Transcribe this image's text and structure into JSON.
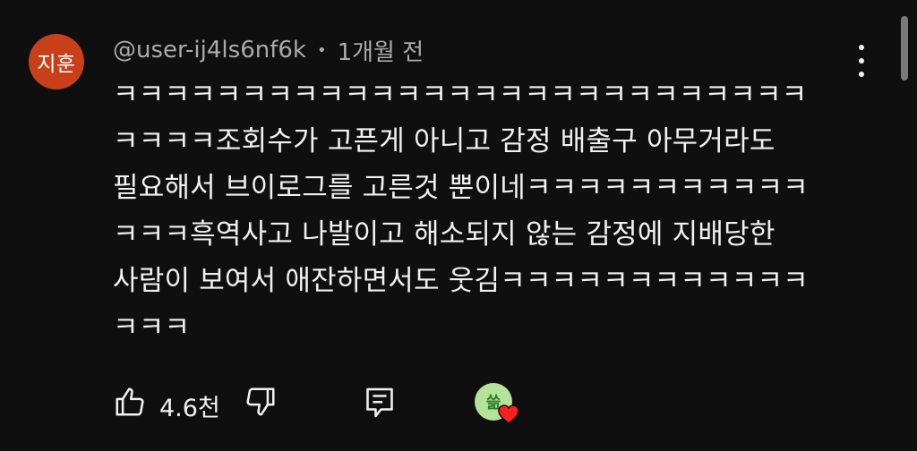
{
  "comment": {
    "avatar_text": "지훈",
    "author": "@user-ij4ls6nf6k",
    "separator": "•",
    "time": "1개월 전",
    "text_lines": [
      "ㅋㅋㅋㅋㅋㅋㅋㅋㅋㅋㅋㅋㅋㅋㅋㅋㅋㅋㅋㅋㅋㅋㅋㅋㅋㅋㅋ",
      "ㅋㅋㅋㅋ조회수가 고픈게 아니고 감정 배출구 아무거라도",
      "필요해서 브이로그를 고른것 뿐이네ㅋㅋㅋㅋㅋㅋㅋㅋㅋㅋㅋ",
      "ㅋㅋㅋ흑역사고 나발이고 해소되지 않는 감정에 지배당한",
      "사람이 보여서 애잔하면서도 웃김ㅋㅋㅋㅋㅋㅋㅋㅋㅋㅋㅋㅋ",
      "ㅋㅋㅋ"
    ]
  },
  "actions": {
    "like_count": "4.6천",
    "like_icon": "thumbs-up-icon",
    "dislike_icon": "thumbs-down-icon",
    "reply_icon": "reply-icon",
    "creator_heart_icon": "heart-icon",
    "creator_avatar_text": "쓺"
  },
  "colors": {
    "background": "#0f0f0f",
    "text": "#f1f1f1",
    "meta": "#aaaaaa",
    "avatar": "#c8401a",
    "heart": "#ff1f1f",
    "creator_avatar": "#b6e39c"
  }
}
